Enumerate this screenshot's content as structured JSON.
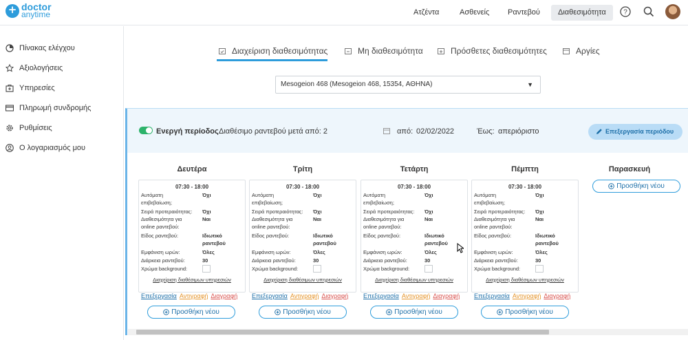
{
  "logo": {
    "line1": "doctor",
    "line2": "anytime"
  },
  "nav": [
    "Ατζέντα",
    "Ασθενείς",
    "Ραντεβού",
    "Διαθεσιμότητα"
  ],
  "nav_active": "Διαθεσιμότητα",
  "header_icons": [
    "help-icon",
    "search-icon",
    "avatar"
  ],
  "sidebar": [
    {
      "label": "Πίνακας ελέγχου",
      "icon": "pie-chart-icon"
    },
    {
      "label": "Αξιολογήσεις",
      "icon": "star-icon"
    },
    {
      "label": "Υπηρεσίες",
      "icon": "medical-bag-icon"
    },
    {
      "label": "Πληρωμή συνδρομής",
      "icon": "credit-card-icon"
    },
    {
      "label": "Ρυθμίσεις",
      "icon": "gear-icon"
    },
    {
      "label": "Ο λογαριασμός μου",
      "icon": "user-icon"
    }
  ],
  "tabs": [
    {
      "label": "Διαχείριση διαθεσιμότητας",
      "active": true
    },
    {
      "label": "Μη διαθεσιμότητα"
    },
    {
      "label": "Πρόσθετες διαθεσιμότητες"
    },
    {
      "label": "Αργίες"
    }
  ],
  "location_select": {
    "value": "Mesogeion 468 (Mesogeion 468, 15354, ΑΘΗΝΑ)"
  },
  "period": {
    "status_label": "Ενεργή περίοδος",
    "availability_text": "Διαθέσιμο ραντεβού μετά από: 2",
    "from_label": "από:",
    "from_value": "02/02/2022",
    "to_label": "Έως:",
    "to_value": "απεριόριστο",
    "edit_button": "Επεξεργασία περιόδου"
  },
  "card_labels": {
    "auto_confirm_1": "Αυτόματη",
    "auto_confirm_2": "επιβεβαίωση;",
    "priority": "Σειρά προτεραιότητας:",
    "online_1": "Διαθεσιμότητα για",
    "online_2": "online ραντεβού:",
    "type": "Είδος ραντεβού:",
    "slots": "Εμφάνιση ωρών:",
    "duration": "Διάρκεια ραντεβού:",
    "bg_color": "Χρώμα background:",
    "manage_services": "Διαχείριση διαθέσιμων υπηρεσιών",
    "edit": "Επεξεργασία",
    "copy": "Αντιγραφή",
    "delete": "Διαγραφή",
    "add_new": "Προσθήκη νέου"
  },
  "days": [
    {
      "name": "Δευτέρα",
      "time": "07:30 - 18:00",
      "auto_confirm": "Όχι",
      "priority": "Όχι",
      "online": "Ναι",
      "type_1": "Ιδιωτικό",
      "type_2": "ραντεβού",
      "slots": "Όλες",
      "duration": "30"
    },
    {
      "name": "Τρίτη",
      "time": "07:30 - 18:00",
      "auto_confirm": "Όχι",
      "priority": "Όχι",
      "online": "Ναι",
      "type_1": "Ιδιωτικό",
      "type_2": "ραντεβού",
      "slots": "Όλες",
      "duration": "30"
    },
    {
      "name": "Τετάρτη",
      "time": "07:30 - 18:00",
      "auto_confirm": "Όχι",
      "priority": "Όχι",
      "online": "Ναι",
      "type_1": "Ιδιωτικό",
      "type_2": "ραντεβού",
      "slots": "Όλες",
      "duration": "30"
    },
    {
      "name": "Πέμπτη",
      "time": "07:30 - 18:00",
      "auto_confirm": "Όχι",
      "priority": "Όχι",
      "online": "Ναι",
      "type_1": "Ιδιωτικό",
      "type_2": "ραντεβού",
      "slots": "Όλες",
      "duration": "30"
    },
    {
      "name": "Παρασκευή"
    }
  ],
  "colors": {
    "accent": "#2d9cdb",
    "active_toggle": "#2db36b",
    "copy": "#e5942a",
    "delete": "#d9534f"
  }
}
